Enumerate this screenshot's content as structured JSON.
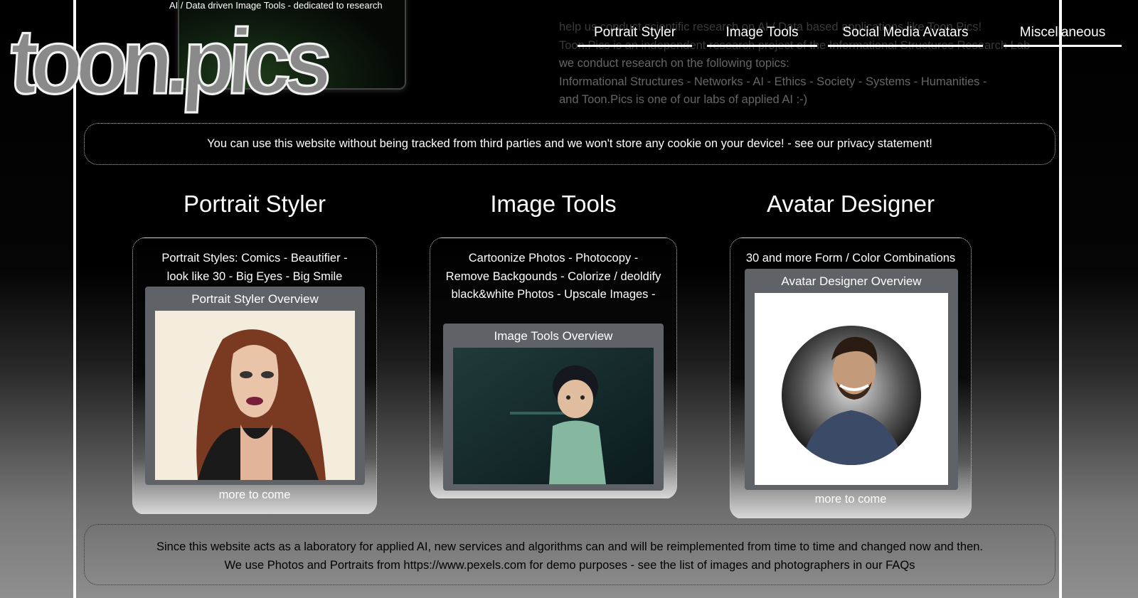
{
  "header": {
    "tagline": "AI / Data driven Image Tools - dedicated to research",
    "logo": "toon.pics",
    "intro_lines": [
      "help us conduct scientific research on AI / Data based applications like Toon.Pics!",
      "Toon.Pics is an independent research project of the Informational Structures Research Lab",
      "we conduct research on the following topics:",
      "Informational Structures - Networks - AI - Ethics - Society - Systems - Humanities -",
      "and Toon.Pics is one of our labs of applied AI :-)"
    ]
  },
  "nav": {
    "items": [
      {
        "label": "Portrait Styler"
      },
      {
        "label": "Image Tools"
      },
      {
        "label": "Social Media Avatars"
      },
      {
        "label": "Miscellaneous"
      }
    ]
  },
  "notice": "You can use this website without being tracked from third parties and we won't store any cookie on your device! - see our privacy statement!",
  "columns": [
    {
      "title": "Portrait Styler",
      "desc_lines": [
        "Portrait Styles: Comics - Beautifier -",
        "look like 30 - Big Eyes - Big Smile"
      ],
      "overview": "Portrait Styler Overview",
      "more": "more to come"
    },
    {
      "title": "Image Tools",
      "desc_lines": [
        "Cartoonize Photos - Photocopy -",
        "Remove Backgounds - Colorize / deoldify",
        "black&white Photos - Upscale Images -"
      ],
      "overview": "Image Tools Overview",
      "more": ""
    },
    {
      "title": "Avatar Designer",
      "desc_lines": [
        "30 and more Form / Color Combinations"
      ],
      "overview": "Avatar Designer Overview",
      "more": "more to come"
    }
  ],
  "footer": {
    "lines": [
      "Since this website acts as a laboratory for applied AI, new services and algorithms can and will be reimplemented from time to time and changed now and then.",
      "We use Photos and Portraits from https://www.pexels.com for demo purposes - see the list of images and photographers in our FAQs"
    ]
  },
  "colors": {
    "background": "#000000",
    "frame_border": "#ffffff",
    "overview_panel": "#5f6368"
  }
}
